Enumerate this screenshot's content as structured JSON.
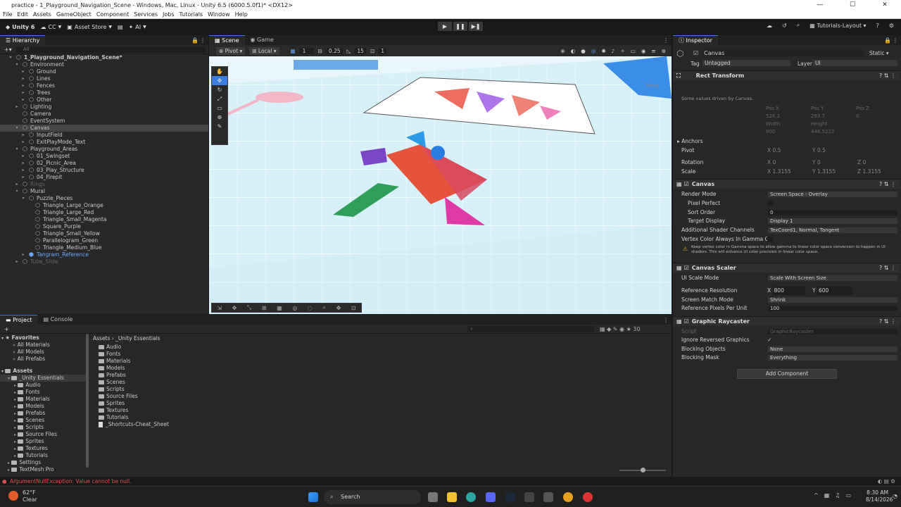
{
  "window": {
    "title": "practice - 1_Playground_Navigation_Scene - Windows, Mac, Linux - Unity 6.5 (6000.5.0f1)* <DX12>",
    "controls": [
      "—",
      "☐",
      "✕"
    ]
  },
  "menu": [
    "File",
    "Edit",
    "Assets",
    "GameObject",
    "Component",
    "Services",
    "Jobs",
    "Tutorials",
    "Window",
    "Help"
  ],
  "toolbar": {
    "unity_label": "Unity 6",
    "account": "CC",
    "asset_store": "Asset Store",
    "ai": "AI",
    "layout": "Tutorials-Layout"
  },
  "hierarchy": {
    "tab": "Hierarchy",
    "search_placeholder": "All",
    "rows": [
      {
        "label": "1_Playground_Navigation_Scene*",
        "depth": 0,
        "arrow": "▾",
        "icon": "unity-scene-icon"
      },
      {
        "label": "Environment",
        "depth": 1,
        "arrow": "▾",
        "icon": "cube-icon"
      },
      {
        "label": "Ground",
        "depth": 2,
        "arrow": "▸",
        "icon": "cube-icon"
      },
      {
        "label": "Lines",
        "depth": 2,
        "arrow": "▸",
        "icon": "cube-icon"
      },
      {
        "label": "Fences",
        "depth": 2,
        "arrow": "▸",
        "icon": "cube-icon"
      },
      {
        "label": "Trees",
        "depth": 2,
        "arrow": "▸",
        "icon": "cube-icon"
      },
      {
        "label": "Other",
        "depth": 2,
        "arrow": "▸",
        "icon": "cube-icon"
      },
      {
        "label": "Lighting",
        "depth": 1,
        "arrow": "▸",
        "icon": "cube-icon"
      },
      {
        "label": "Camera",
        "depth": 1,
        "arrow": "",
        "icon": "cube-icon"
      },
      {
        "label": "EventSystem",
        "depth": 1,
        "arrow": "",
        "icon": "cube-icon"
      },
      {
        "label": "Canvas",
        "depth": 1,
        "arrow": "▾",
        "icon": "cube-icon",
        "state": "sel"
      },
      {
        "label": "InputField",
        "depth": 2,
        "arrow": "▸",
        "icon": "cube-icon"
      },
      {
        "label": "ExitPlayMode_Text",
        "depth": 2,
        "arrow": "▸",
        "icon": "cube-icon"
      },
      {
        "label": "Playground_Areas",
        "depth": 1,
        "arrow": "▾",
        "icon": "cube-icon"
      },
      {
        "label": "01_Swingset",
        "depth": 2,
        "arrow": "▸",
        "icon": "cube-icon"
      },
      {
        "label": "02_Picnic_Area",
        "depth": 2,
        "arrow": "▸",
        "icon": "cube-icon"
      },
      {
        "label": "03_Play_Structure",
        "depth": 2,
        "arrow": "▸",
        "icon": "cube-icon"
      },
      {
        "label": "04_Firepit",
        "depth": 2,
        "arrow": "▸",
        "icon": "cube-icon"
      },
      {
        "label": "Rings",
        "depth": 1,
        "arrow": "▸",
        "icon": "cube-icon",
        "state": "dim"
      },
      {
        "label": "Mural",
        "depth": 1,
        "arrow": "▾",
        "icon": "cube-icon"
      },
      {
        "label": "Puzzle_Pieces",
        "depth": 2,
        "arrow": "▾",
        "icon": "cube-icon"
      },
      {
        "label": "Triangle_Large_Orange",
        "depth": 3,
        "arrow": "",
        "icon": "cube-icon"
      },
      {
        "label": "Triangle_Large_Red",
        "depth": 3,
        "arrow": "",
        "icon": "cube-icon"
      },
      {
        "label": "Triangle_Small_Magenta",
        "depth": 3,
        "arrow": "",
        "icon": "cube-icon"
      },
      {
        "label": "Square_Purple",
        "depth": 3,
        "arrow": "",
        "icon": "cube-icon"
      },
      {
        "label": "Triangle_Small_Yellow",
        "depth": 3,
        "arrow": "",
        "icon": "cube-icon"
      },
      {
        "label": "Parallelogram_Green",
        "depth": 3,
        "arrow": "",
        "icon": "cube-icon"
      },
      {
        "label": "Triangle_Medium_Blue",
        "depth": 3,
        "arrow": "",
        "icon": "cube-icon"
      },
      {
        "label": "Tangram_Reference",
        "depth": 2,
        "arrow": "▸",
        "icon": "prefab-icon",
        "state": "blue"
      },
      {
        "label": "Tube_Slide",
        "depth": 1,
        "arrow": "▸",
        "icon": "cube-icon",
        "state": "dim"
      }
    ]
  },
  "scene": {
    "tabs": [
      "Scene",
      "Game"
    ],
    "pivot": "Pivot",
    "local": "Local",
    "grid_value": "1",
    "snap_value": "0.25",
    "angle_value": "15",
    "scale_value": "1",
    "persp_label": "Persp"
  },
  "inspector": {
    "tab": "Inspector",
    "object_name": "Canvas",
    "static_label": "Static",
    "tag_label": "Tag",
    "tag_value": "Untagged",
    "layer_label": "Layer",
    "layer_value": "UI",
    "rect_transform": {
      "title": "Rect Transform",
      "note": "Some values driven by Canvas.",
      "pos_x_label": "Pos X",
      "pos_y_label": "Pos Y",
      "pos_z_label": "Pos Z",
      "pos_x": "526.2",
      "pos_y": "293.7",
      "pos_z": "0",
      "width_label": "Width",
      "height_label": "Height",
      "width": "800",
      "height": "446.5222",
      "anchors": "Anchors",
      "pivot_label": "Pivot",
      "pivot_x": "0.5",
      "pivot_y": "0.5",
      "rotation_label": "Rotation",
      "rot_x": "0",
      "rot_y": "0",
      "rot_z": "0",
      "scale_label": "Scale",
      "scale_x": "1.3155",
      "scale_y": "1.3155",
      "scale_z": "1.3155"
    },
    "canvas": {
      "title": "Canvas",
      "render_mode_label": "Render Mode",
      "render_mode": "Screen Space - Overlay",
      "pixel_perfect_label": "Pixel Perfect",
      "sort_order_label": "Sort Order",
      "sort_order": "0",
      "target_display_label": "Target Display",
      "target_display": "Display 1",
      "shader_channels_label": "Additional Shader Channels",
      "shader_channels": "TexCoord1, Normal, Tangent",
      "vertex_color_label": "Vertex Color Always In Gamma Co",
      "warning": "Keep vertex color in Gamma space to allow gamma to linear color space conversion to happen in UI shaders. This will enhance UI color precision in linear color space."
    },
    "canvas_scaler": {
      "title": "Canvas Scaler",
      "ui_scale_label": "UI Scale Mode",
      "ui_scale": "Scale With Screen Size",
      "ref_res_label": "Reference Resolution",
      "ref_x": "800",
      "ref_y": "600",
      "match_label": "Screen Match Mode",
      "match": "Shrink",
      "ppu_label": "Reference Pixels Per Unit",
      "ppu": "100"
    },
    "raycaster": {
      "title": "Graphic Raycaster",
      "script_label": "Script",
      "script": "GraphicRaycaster",
      "ignore_label": "Ignore Reversed Graphics",
      "blocking_label": "Blocking Objects",
      "blocking": "None",
      "mask_label": "Blocking Mask",
      "mask": "Everything"
    },
    "add_component": "Add Component"
  },
  "project": {
    "tabs": [
      "Project",
      "Console"
    ],
    "favorites_label": "Favorites",
    "favorites": [
      "All Materials",
      "All Models",
      "All Prefabs"
    ],
    "assets_label": "Assets",
    "tree": [
      "_Unity Essentials",
      "Audio",
      "Fonts",
      "Materials",
      "Models",
      "Prefabs",
      "Scenes",
      "Scripts",
      "Source Files",
      "Sprites",
      "Textures",
      "Tutorials",
      "Settings",
      "TextMesh Pro"
    ],
    "breadcrumb": "Assets  ›  _Unity Essentials",
    "files": [
      "Audio",
      "Fonts",
      "Materials",
      "Models",
      "Prefabs",
      "Scenes",
      "Scripts",
      "Source Files",
      "Sprites",
      "Textures",
      "Tutorials",
      "_Shortcuts-Cheat_Sheet"
    ],
    "count_badge": "30"
  },
  "status": {
    "error": "ArgumentNullException: Value cannot be null."
  },
  "taskbar": {
    "weather_temp": "62°F",
    "weather_desc": "Clear",
    "search": "Search",
    "time": "8:30 AM",
    "date": "8/14/2026"
  },
  "colors": {
    "accent": "#3d7de0",
    "selection": "#444444",
    "error": "#e05050",
    "prefab": "#6fa8ff"
  }
}
